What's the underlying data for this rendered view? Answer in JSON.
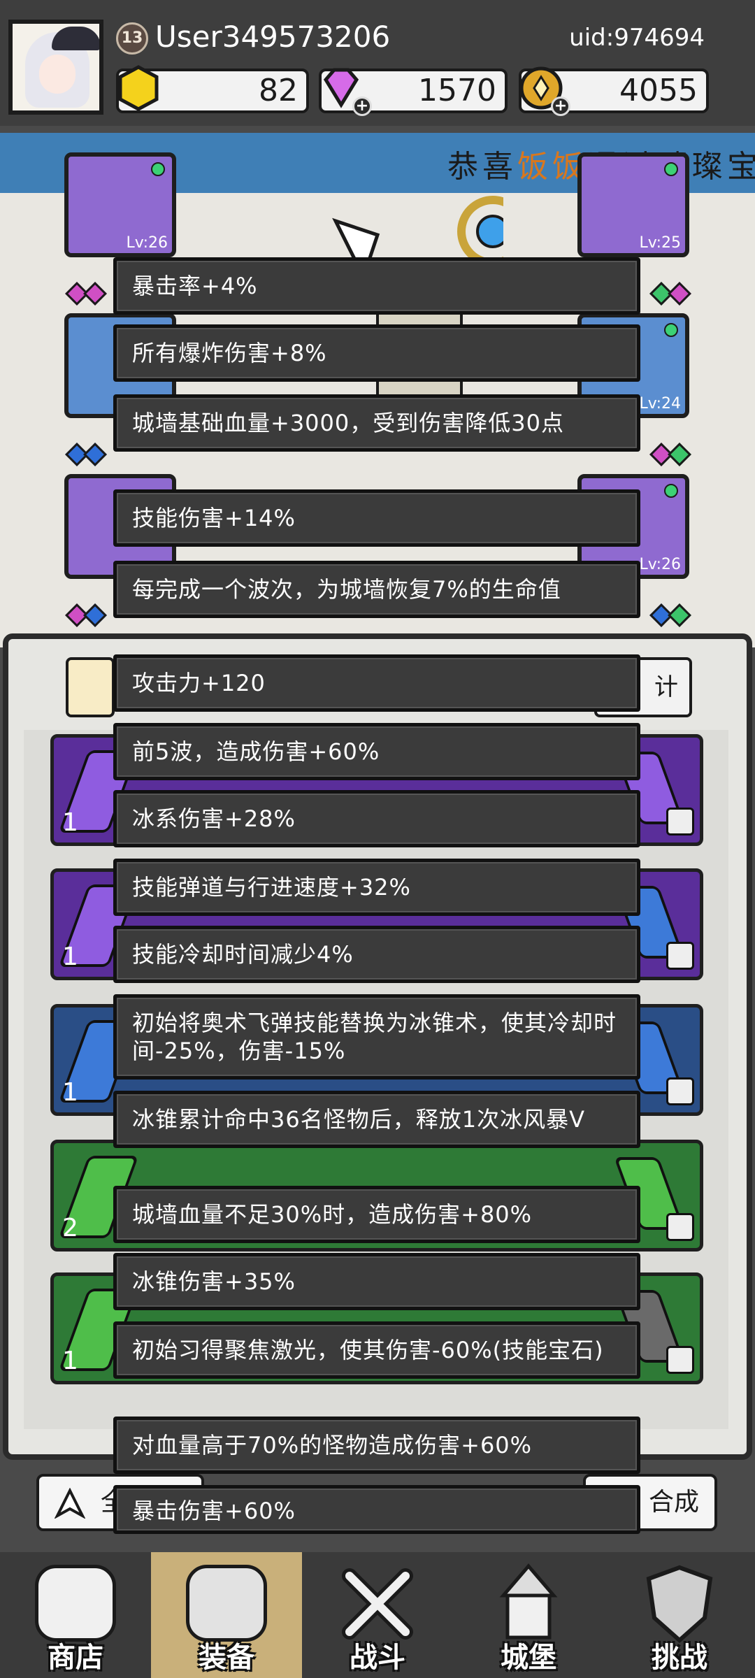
{
  "header": {
    "level": "13",
    "username": "User349573206",
    "uid": "uid:974694",
    "currencies": {
      "gold_gem": "82",
      "diamonds": "1570",
      "coins": "4055"
    }
  },
  "announcement": {
    "prefix": "恭喜",
    "player": "饭饭",
    "suffix": "通过璀璨宝石"
  },
  "equipment_slots": [
    "Lv:26",
    "Lv:25",
    "Lv:24",
    "Lv:26"
  ],
  "gem_counts": [
    "1",
    "1",
    "1",
    "2",
    "1"
  ],
  "bag": {
    "right_tab": "计",
    "left_button": "全",
    "right_button": "合成"
  },
  "tooltips": [
    "暴击率+4%",
    "所有爆炸伤害+8%",
    "城墙基础血量+3000，受到伤害降低30点",
    "技能伤害+14%",
    "每完成一个波次，为城墙恢复7%的生命值",
    "攻击力+120",
    "前5波，造成伤害+60%",
    "冰系伤害+28%",
    "技能弹道与行进速度+32%",
    "技能冷却时间减少4%",
    "初始将奥术飞弹技能替换为冰锥术，使其冷却时间-25%，伤害-15%",
    "冰锥累计命中36名怪物后，释放1次冰风暴V",
    "城墙血量不足30%时，造成伤害+80%",
    "冰锥伤害+35%",
    "初始习得聚焦激光，使其伤害-60%(技能宝石)",
    "对血量高于70%的怪物造成伤害+60%",
    "暴击伤害+60%"
  ],
  "nav": [
    "商店",
    "装备",
    "战斗",
    "城堡",
    "挑战"
  ]
}
